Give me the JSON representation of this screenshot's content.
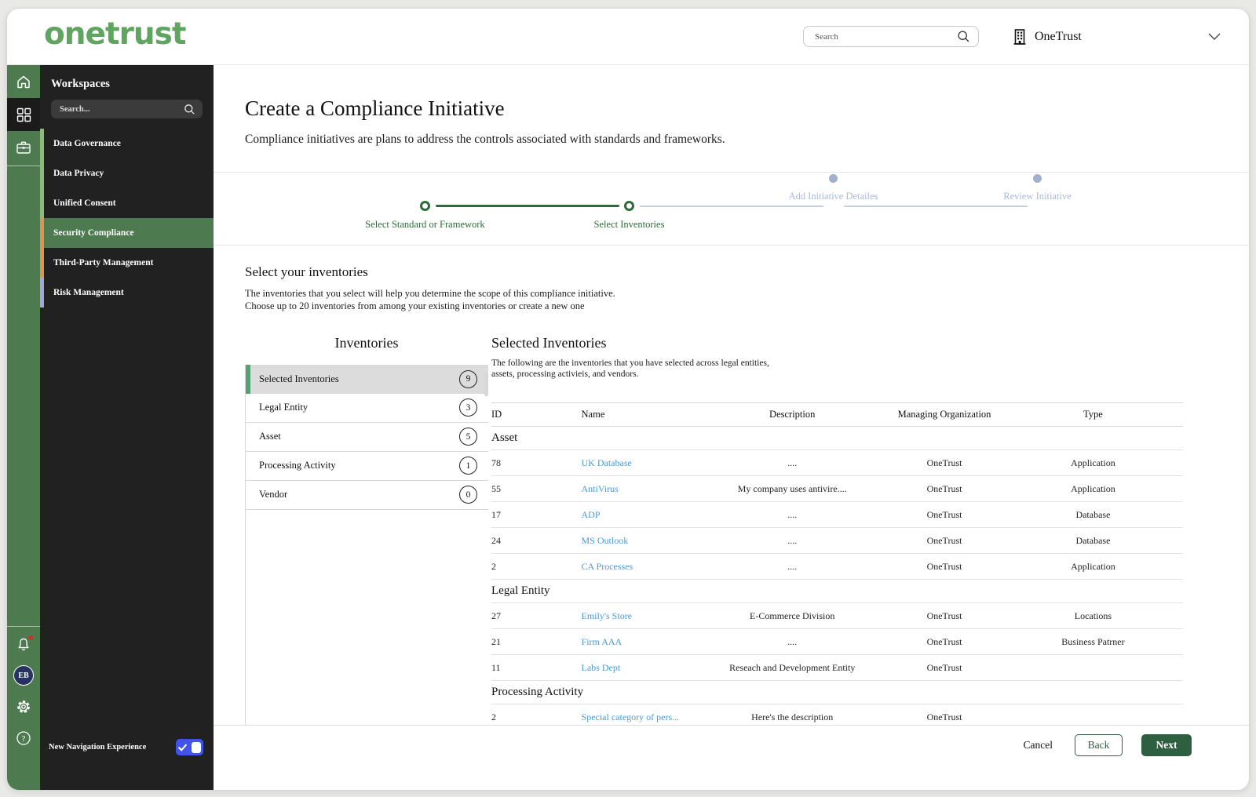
{
  "header": {
    "logo": "onetrust",
    "search_placeholder": "Search",
    "org_name": "OneTrust"
  },
  "rail": {
    "avatar_initials": "EB"
  },
  "workspaces": {
    "title": "Workspaces",
    "search_placeholder": "Search...",
    "items": [
      {
        "label": "Data Governance",
        "bar_color": "#8cbb73",
        "selected": false
      },
      {
        "label": "Data Privacy",
        "bar_color": "#8cbb73",
        "selected": false
      },
      {
        "label": "Unified Consent",
        "bar_color": "#8cbb73",
        "selected": false
      },
      {
        "label": "Security Compliance",
        "bar_color": "#e0934e",
        "selected": true
      },
      {
        "label": "Third-Party Management",
        "bar_color": "#e0934e",
        "selected": false
      },
      {
        "label": "Risk Management",
        "bar_color": "#a3a4de",
        "selected": false
      }
    ],
    "footer_toggle_label": "New Navigation Experience",
    "toggle_on": true
  },
  "page": {
    "title": "Create a Compliance Initiative",
    "subtitle": "Compliance initiatives are plans to address the controls associated with standards and frameworks."
  },
  "stepper": {
    "steps": [
      {
        "label": "Select Standard or Framework",
        "done": true
      },
      {
        "label": "Select Inventories",
        "done": true
      },
      {
        "label": "Add Initiative Detailes",
        "done": false
      },
      {
        "label": "Review Initiative",
        "done": false
      }
    ]
  },
  "section": {
    "heading": "Select your inventories",
    "description_line1": "The inventories that you select will help you determine the scope of this compliance initiative.",
    "description_line2": "Choose up to 20 inventories from among your existing inventories or create a new one"
  },
  "inventories_panel": {
    "title": "Inventories",
    "items": [
      {
        "label": "Selected Inventories",
        "count": 9,
        "selected": true
      },
      {
        "label": "Legal Entity",
        "count": 3,
        "selected": false
      },
      {
        "label": "Asset",
        "count": 5,
        "selected": false
      },
      {
        "label": "Processing Activity",
        "count": 1,
        "selected": false
      },
      {
        "label": "Vendor",
        "count": 0,
        "selected": false
      }
    ]
  },
  "selected_panel": {
    "title": "Selected Inventories",
    "description_line1": "The following are the inventories that you have selected across legal entities,",
    "description_line2": "assets, processing activieis, and vendors.",
    "table": {
      "columns": [
        "ID",
        "Name",
        "Description",
        "Managing Organization",
        "Type"
      ],
      "groups": [
        {
          "name": "Asset",
          "rows": [
            {
              "id": "78",
              "name": "UK Database",
              "description": "....",
              "managing_organization": "OneTrust",
              "type": "Application"
            },
            {
              "id": "55",
              "name": "AntiVirus",
              "description": "My company uses antivire....",
              "managing_organization": "OneTrust",
              "type": "Application"
            },
            {
              "id": "17",
              "name": "ADP",
              "description": "....",
              "managing_organization": "OneTrust",
              "type": "Database"
            },
            {
              "id": "24",
              "name": "MS Outlook",
              "description": "....",
              "managing_organization": "OneTrust",
              "type": "Database"
            },
            {
              "id": "2",
              "name": "CA Processes",
              "description": "....",
              "managing_organization": "OneTrust",
              "type": "Application"
            }
          ]
        },
        {
          "name": "Legal Entity",
          "rows": [
            {
              "id": "27",
              "name": "Emily's Store",
              "description": "E-Commerce Division",
              "managing_organization": "OneTrust",
              "type": "Locations"
            },
            {
              "id": "21",
              "name": "Firm AAA",
              "description": "....",
              "managing_organization": "OneTrust",
              "type": "Business Patrner"
            },
            {
              "id": "11",
              "name": "Labs Dept",
              "description": "Reseach and Development Entity",
              "managing_organization": "OneTrust",
              "type": ""
            }
          ]
        },
        {
          "name": "Processing Activity",
          "rows": [
            {
              "id": "2",
              "name": "Special category of pers...",
              "description": "Here's the description",
              "managing_organization": "OneTrust",
              "type": ""
            }
          ]
        }
      ]
    }
  },
  "footer": {
    "cancel_label": "Cancel",
    "back_label": "Back",
    "next_label": "Next"
  },
  "colors": {
    "brand_green": "#5fa560",
    "sidebar_green": "#4e7a50",
    "stepper_active_green": "#2c6b37",
    "stepper_inactive": "#9fb1ce",
    "link_blue": "#4a9bd5",
    "toggle_blue": "#4154e8",
    "next_button_green": "#2e5f41",
    "selected_bar_green": "#55a173"
  }
}
